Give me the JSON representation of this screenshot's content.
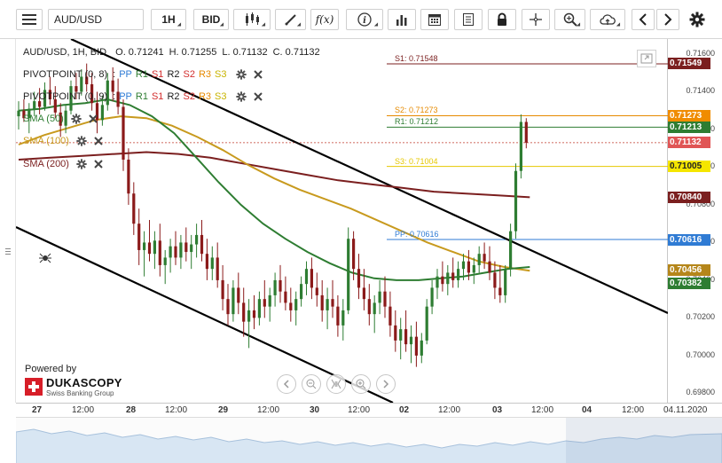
{
  "toolbar": {
    "symbol": "AUD/USD",
    "timeframe": "1H",
    "side": "BID",
    "buttons": [
      "menu-icon",
      "candle-type-icon",
      "draw-icon",
      "function-icon",
      "info-icon",
      "indicators-icon",
      "calendar-icon",
      "report-icon",
      "lock-icon",
      "crosshair-icon",
      "zoom-icon",
      "cloud-icon",
      "arrow-left-icon",
      "arrow-right-icon",
      "settings-icon"
    ],
    "fx_label": "f(x)"
  },
  "ohlc": {
    "symbol_line": "AUD/USD, 1H, BID",
    "open": "O. 0.71241",
    "high": "H. 0.71255",
    "low": "L. 0.71132",
    "close": "C. 0.71132"
  },
  "pivots": [
    {
      "label": "PIVOTPOINT (0, 8)",
      "items": [
        "PP",
        "R1",
        "S1",
        "R2",
        "S2",
        "R3",
        "S3"
      ]
    },
    {
      "label": "PIVOTPOINT (0, 9)",
      "items": [
        "PP",
        "R1",
        "S1",
        "R2",
        "S2",
        "R3",
        "S3"
      ]
    }
  ],
  "smas": [
    {
      "label": "SMA (50)",
      "color": "#2e7d32"
    },
    {
      "label": "SMA (100)",
      "color": "#c89a1e"
    },
    {
      "label": "SMA (200)",
      "color": "#7b1f1f"
    }
  ],
  "levels": [
    {
      "label": "S1: 0.71548",
      "color": "#7b1f1f"
    },
    {
      "label": "S2: 0.71273",
      "color": "#e68a00"
    },
    {
      "label": "R1: 0.71212",
      "color": "#2e7d32"
    },
    {
      "label": "S3: 0.71004",
      "color": "#e6c800"
    },
    {
      "label": "PP: 0.70616",
      "color": "#2f7bd4"
    }
  ],
  "price_axis": [
    "0.71600",
    "0.71400",
    "0.71200",
    "0.71000",
    "0.70800",
    "0.70600",
    "0.70400",
    "0.70200",
    "0.70000",
    "0.69800"
  ],
  "price_tags": [
    {
      "value": "0.71549",
      "bg": "#7b1f1f",
      "fg": "#ffffff"
    },
    {
      "value": "0.71273",
      "bg": "#f08c00",
      "fg": "#ffffff"
    },
    {
      "value": "0.71213",
      "bg": "#2e7d32",
      "fg": "#ffffff"
    },
    {
      "value": "0.71132",
      "bg": "#e05555",
      "fg": "#ffffff"
    },
    {
      "value": "0.71005",
      "bg": "#f5e600",
      "fg": "#222222"
    },
    {
      "value": "0.70840",
      "bg": "#7b1f1f",
      "fg": "#ffffff"
    },
    {
      "value": "0.70616",
      "bg": "#2f7bd4",
      "fg": "#ffffff"
    },
    {
      "value": "0.70456",
      "bg": "#b5861a",
      "fg": "#ffffff"
    },
    {
      "value": "0.70382",
      "bg": "#2e7d32",
      "fg": "#ffffff"
    }
  ],
  "time_axis": [
    {
      "label": "27",
      "day": true
    },
    {
      "label": "12:00",
      "day": false
    },
    {
      "label": "28",
      "day": true
    },
    {
      "label": "12:00",
      "day": false
    },
    {
      "label": "29",
      "day": true
    },
    {
      "label": "12:00",
      "day": false
    },
    {
      "label": "30",
      "day": true
    },
    {
      "label": "12:00",
      "day": false
    },
    {
      "label": "02",
      "day": true
    },
    {
      "label": "12:00",
      "day": false
    },
    {
      "label": "03",
      "day": true
    },
    {
      "label": "12:00",
      "day": false
    },
    {
      "label": "04",
      "day": true
    },
    {
      "label": "12:00",
      "day": false
    },
    {
      "label": "04.11.2020",
      "day": false
    }
  ],
  "powered": {
    "by": "Powered by",
    "name": "DUKASCOPY",
    "sub": "Swiss Banking Group"
  },
  "chart_data": {
    "type": "candlestick",
    "symbol": "AUD/USD",
    "timeframe": "1H",
    "ylim": [
      0.6975,
      0.7168
    ],
    "candles": [
      [
        0.7127,
        0.7135,
        0.712,
        0.713
      ],
      [
        0.713,
        0.7136,
        0.7124,
        0.7126
      ],
      [
        0.7126,
        0.7134,
        0.7118,
        0.7131
      ],
      [
        0.7131,
        0.714,
        0.7127,
        0.7135
      ],
      [
        0.7135,
        0.7142,
        0.7128,
        0.7132
      ],
      [
        0.7132,
        0.7145,
        0.713,
        0.7141
      ],
      [
        0.7141,
        0.7148,
        0.7133,
        0.7136
      ],
      [
        0.7136,
        0.7143,
        0.7126,
        0.7129
      ],
      [
        0.7129,
        0.7134,
        0.7116,
        0.7122
      ],
      [
        0.7122,
        0.7133,
        0.7118,
        0.713
      ],
      [
        0.713,
        0.7146,
        0.7128,
        0.7143
      ],
      [
        0.7143,
        0.715,
        0.7136,
        0.714
      ],
      [
        0.714,
        0.7152,
        0.7138,
        0.7148
      ],
      [
        0.7148,
        0.7155,
        0.714,
        0.7144
      ],
      [
        0.7144,
        0.715,
        0.713,
        0.7134
      ],
      [
        0.7134,
        0.714,
        0.7118,
        0.7125
      ],
      [
        0.7125,
        0.7138,
        0.7122,
        0.7133
      ],
      [
        0.7133,
        0.715,
        0.713,
        0.7146
      ],
      [
        0.7146,
        0.7153,
        0.7135,
        0.714
      ],
      [
        0.714,
        0.7147,
        0.7128,
        0.7132
      ],
      [
        0.7132,
        0.7136,
        0.7098,
        0.7104
      ],
      [
        0.7104,
        0.711,
        0.708,
        0.7086
      ],
      [
        0.7086,
        0.7092,
        0.7064,
        0.707
      ],
      [
        0.707,
        0.7078,
        0.7048,
        0.7056
      ],
      [
        0.7056,
        0.7066,
        0.7042,
        0.706
      ],
      [
        0.706,
        0.7072,
        0.705,
        0.7054
      ],
      [
        0.7054,
        0.7066,
        0.7046,
        0.7061
      ],
      [
        0.7061,
        0.707,
        0.7042,
        0.7048
      ],
      [
        0.7048,
        0.7056,
        0.7038,
        0.7052
      ],
      [
        0.7052,
        0.7062,
        0.7044,
        0.7058
      ],
      [
        0.7058,
        0.7066,
        0.7048,
        0.7052
      ],
      [
        0.7052,
        0.7064,
        0.7046,
        0.706
      ],
      [
        0.706,
        0.7068,
        0.705,
        0.7055
      ],
      [
        0.7055,
        0.7064,
        0.7046,
        0.7059
      ],
      [
        0.7059,
        0.707,
        0.7052,
        0.7064
      ],
      [
        0.7064,
        0.7072,
        0.705,
        0.7054
      ],
      [
        0.7054,
        0.7062,
        0.704,
        0.7046
      ],
      [
        0.7046,
        0.7058,
        0.704,
        0.7052
      ],
      [
        0.7052,
        0.706,
        0.7036,
        0.704
      ],
      [
        0.704,
        0.7048,
        0.7024,
        0.703
      ],
      [
        0.703,
        0.7038,
        0.7016,
        0.7022
      ],
      [
        0.7022,
        0.704,
        0.7018,
        0.7036
      ],
      [
        0.7036,
        0.7044,
        0.7022,
        0.7028
      ],
      [
        0.7028,
        0.7036,
        0.701,
        0.7018
      ],
      [
        0.7018,
        0.703,
        0.7004,
        0.7024
      ],
      [
        0.7024,
        0.7032,
        0.7014,
        0.702
      ],
      [
        0.702,
        0.7034,
        0.7016,
        0.703
      ],
      [
        0.703,
        0.704,
        0.702,
        0.7026
      ],
      [
        0.7026,
        0.7036,
        0.7018,
        0.7032
      ],
      [
        0.7032,
        0.7044,
        0.7026,
        0.704
      ],
      [
        0.704,
        0.7048,
        0.7028,
        0.7034
      ],
      [
        0.7034,
        0.7042,
        0.7024,
        0.7028
      ],
      [
        0.7028,
        0.7036,
        0.7018,
        0.7024
      ],
      [
        0.7024,
        0.7034,
        0.7016,
        0.703
      ],
      [
        0.703,
        0.7042,
        0.7026,
        0.7038
      ],
      [
        0.7038,
        0.705,
        0.7032,
        0.7046
      ],
      [
        0.7046,
        0.7052,
        0.703,
        0.7036
      ],
      [
        0.7036,
        0.7044,
        0.7026,
        0.7032
      ],
      [
        0.7032,
        0.704,
        0.7018,
        0.7024
      ],
      [
        0.7024,
        0.7036,
        0.7014,
        0.703
      ],
      [
        0.703,
        0.704,
        0.702,
        0.7026
      ],
      [
        0.7026,
        0.7032,
        0.701,
        0.7016
      ],
      [
        0.7016,
        0.703,
        0.7008,
        0.7024
      ],
      [
        0.7024,
        0.7068,
        0.7022,
        0.7062
      ],
      [
        0.7062,
        0.7066,
        0.704,
        0.7046
      ],
      [
        0.7046,
        0.7054,
        0.703,
        0.7036
      ],
      [
        0.7036,
        0.7046,
        0.7024,
        0.703
      ],
      [
        0.703,
        0.7038,
        0.7016,
        0.7022
      ],
      [
        0.7022,
        0.7032,
        0.7012,
        0.7028
      ],
      [
        0.7028,
        0.704,
        0.7022,
        0.7034
      ],
      [
        0.7034,
        0.7042,
        0.702,
        0.7026
      ],
      [
        0.7026,
        0.7034,
        0.701,
        0.7016
      ],
      [
        0.7016,
        0.7024,
        0.7002,
        0.7008
      ],
      [
        0.7008,
        0.702,
        0.6998,
        0.7014
      ],
      [
        0.7014,
        0.7024,
        0.7002,
        0.7006
      ],
      [
        0.7006,
        0.7016,
        0.6996,
        0.701
      ],
      [
        0.701,
        0.7018,
        0.6994,
        0.7
      ],
      [
        0.7,
        0.7012,
        0.6996,
        0.7008
      ],
      [
        0.7008,
        0.703,
        0.7006,
        0.7026
      ],
      [
        0.7026,
        0.704,
        0.7022,
        0.7036
      ],
      [
        0.7036,
        0.7046,
        0.703,
        0.7042
      ],
      [
        0.7042,
        0.705,
        0.7034,
        0.7038
      ],
      [
        0.7038,
        0.7048,
        0.7032,
        0.7044
      ],
      [
        0.7044,
        0.7052,
        0.7036,
        0.704
      ],
      [
        0.704,
        0.705,
        0.7036,
        0.7046
      ],
      [
        0.7046,
        0.7054,
        0.704,
        0.705
      ],
      [
        0.705,
        0.7056,
        0.704,
        0.7044
      ],
      [
        0.7044,
        0.7052,
        0.7038,
        0.7048
      ],
      [
        0.7048,
        0.7058,
        0.7044,
        0.7054
      ],
      [
        0.7054,
        0.706,
        0.7046,
        0.705
      ],
      [
        0.705,
        0.7058,
        0.704,
        0.7044
      ],
      [
        0.7044,
        0.705,
        0.703,
        0.7036
      ],
      [
        0.7036,
        0.7048,
        0.7028,
        0.7032
      ],
      [
        0.7032,
        0.7048,
        0.7028,
        0.7046
      ],
      [
        0.7046,
        0.707,
        0.7042,
        0.7066
      ],
      [
        0.7066,
        0.7102,
        0.7062,
        0.7098
      ],
      [
        0.7098,
        0.7128,
        0.7094,
        0.7124
      ],
      [
        0.7124,
        0.7126,
        0.711,
        0.7113
      ]
    ],
    "sma50": [
      0.713,
      0.7131,
      0.7133,
      0.7134,
      0.7136,
      0.7133,
      0.7127,
      0.7118,
      0.7105,
      0.7092,
      0.708,
      0.707,
      0.7062,
      0.7055,
      0.7049,
      0.7044,
      0.7041,
      0.704,
      0.704,
      0.7041,
      0.7042,
      0.7044,
      0.7046,
      0.7047
    ],
    "sma100": [
      0.7112,
      0.7117,
      0.7121,
      0.7125,
      0.7127,
      0.7126,
      0.7122,
      0.7116,
      0.7109,
      0.7101,
      0.7094,
      0.7088,
      0.7083,
      0.7078,
      0.7072,
      0.7066,
      0.706,
      0.7055,
      0.705,
      0.7047,
      0.7045
    ],
    "sma200": [
      0.7104,
      0.7105,
      0.7106,
      0.7107,
      0.7108,
      0.7107,
      0.7105,
      0.7102,
      0.7099,
      0.7096,
      0.7093,
      0.7091,
      0.7089,
      0.7087,
      0.7086,
      0.7085,
      0.7084
    ]
  }
}
